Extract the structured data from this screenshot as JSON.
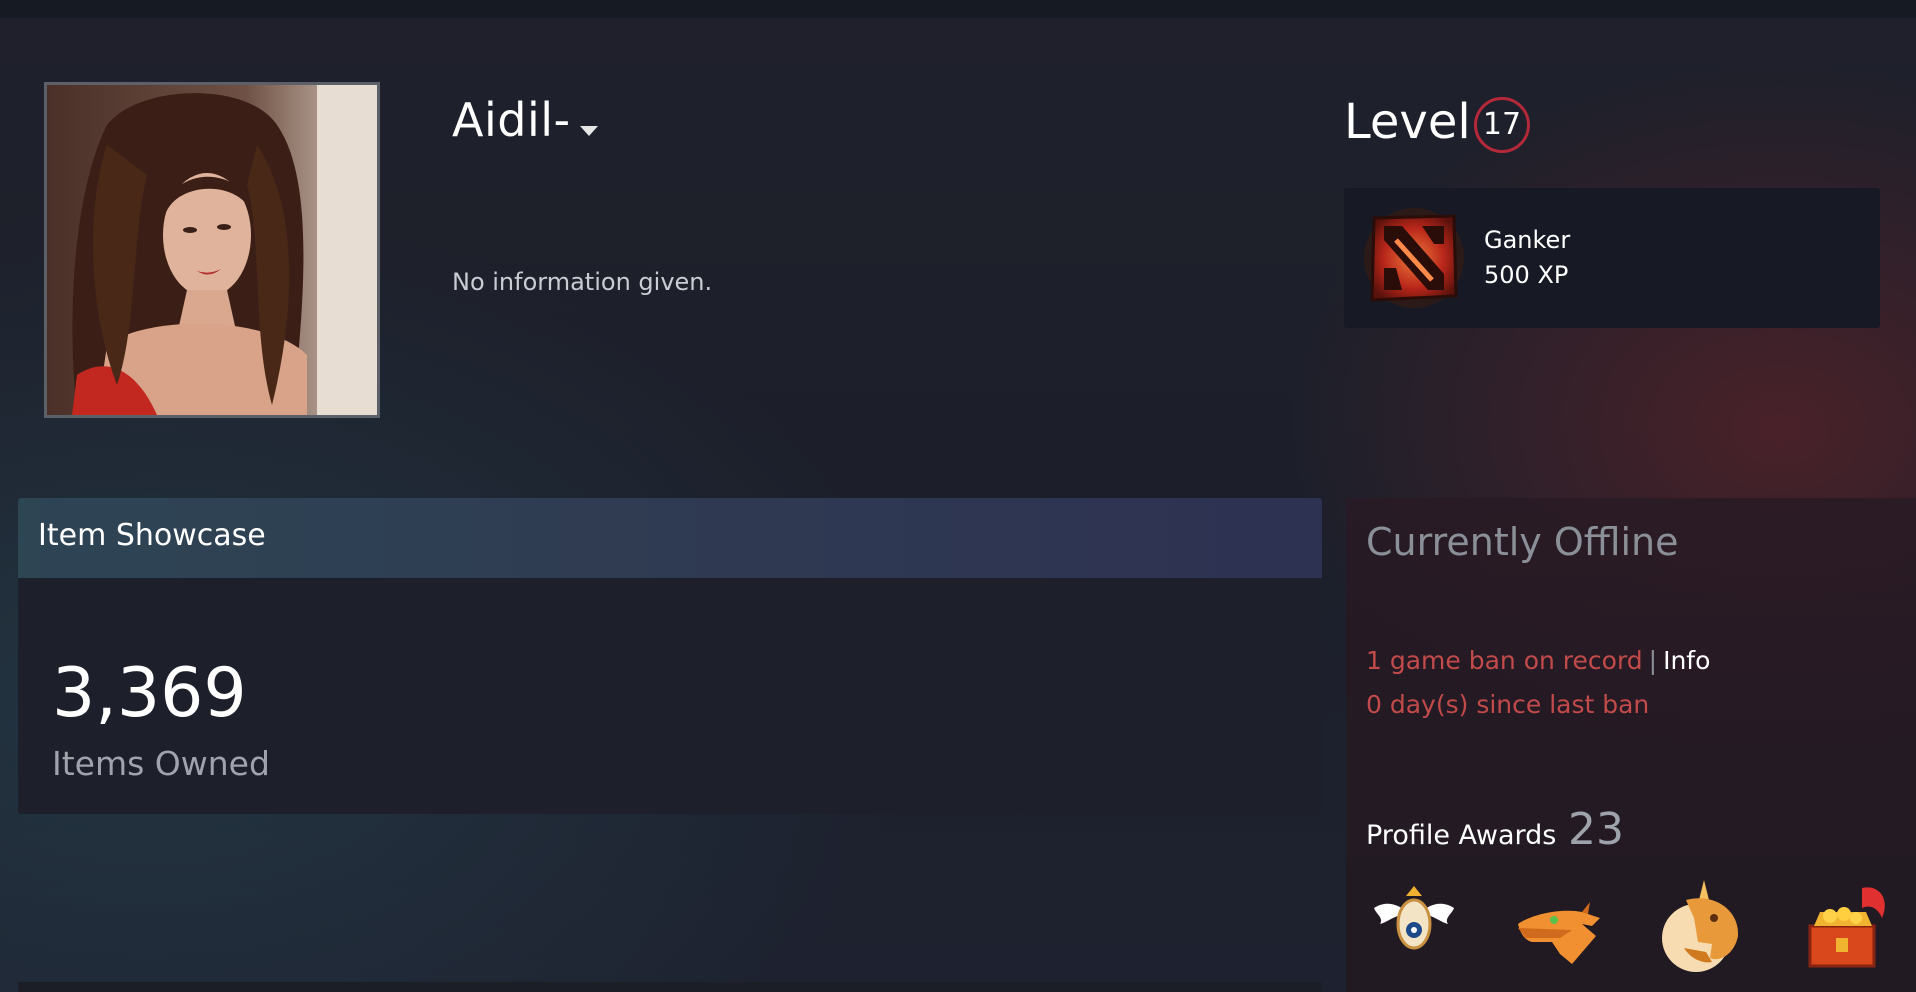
{
  "profile": {
    "persona_name": "Aidil-",
    "summary": "No information given."
  },
  "level": {
    "label": "Level",
    "value": "17",
    "color": "#b4293a"
  },
  "featured_badge": {
    "name": "Ganker",
    "xp": "500 XP",
    "icon": "dota2-badge-icon"
  },
  "showcase": {
    "title": "Item Showcase",
    "count": "3,369",
    "count_label": "Items Owned"
  },
  "status": {
    "text": "Currently Offline",
    "ban_text": "1 game ban on record",
    "separator": "|",
    "ban_info_link": "Info",
    "days_since_ban": "0 day(s) since last ban",
    "ban_color": "#c24a4a"
  },
  "awards": {
    "label": "Profile Awards",
    "count": "23",
    "icons": [
      "winged-steam-award-icon",
      "dragon-head-award-icon",
      "unicorn-award-icon",
      "treasure-chest-award-icon"
    ]
  }
}
